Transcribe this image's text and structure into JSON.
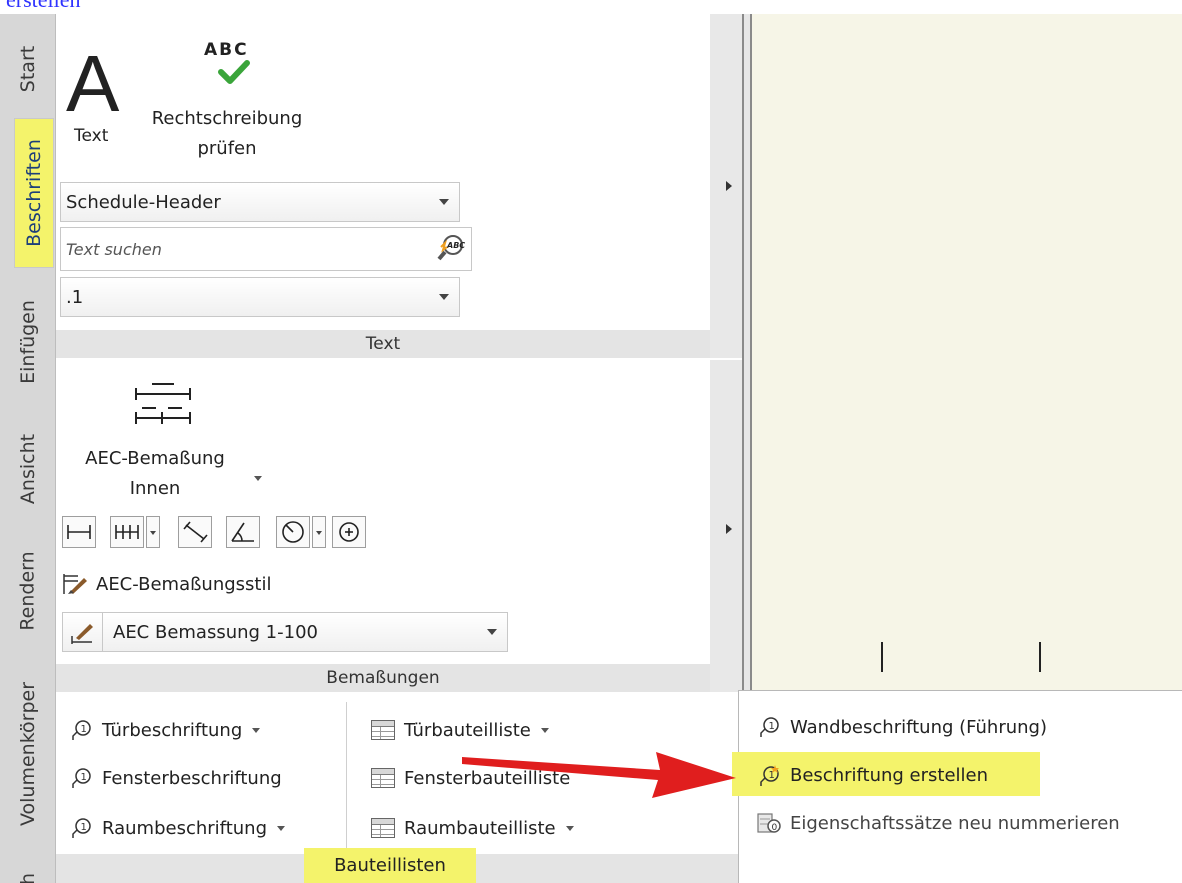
{
  "header_link": "erstellen",
  "tabs": [
    "Start",
    "Beschriften",
    "Einfügen",
    "Ansicht",
    "Rendern",
    "Volumenkörper",
    "h"
  ],
  "text_panel": {
    "text_button": "Text",
    "text_glyph": "A",
    "spell_button": "Rechtschreibung prüfen",
    "spell_icon_text": "ABC",
    "style_combo": "Schedule-Header",
    "search_placeholder": "Text suchen",
    "height_combo": ".1",
    "title": "Text"
  },
  "dim_panel": {
    "dim_button_line1": "AEC-Bemaßung",
    "dim_button_line2": "Innen",
    "style_button": "AEC-Bemaßungsstil",
    "style_combo": "AEC Bemassung 1-100",
    "title": "Bemaßungen"
  },
  "schedule_panel": {
    "tags": [
      "Türbeschriftung",
      "Fensterbeschriftung",
      "Raumbeschriftung"
    ],
    "tables": [
      "Türbauteilliste",
      "Fensterbauteilliste",
      "Raumbauteilliste"
    ],
    "title": "Bauteillisten"
  },
  "flyout": {
    "items": [
      "Wandbeschriftung (Führung)",
      "Beschriftung erstellen",
      "Eigenschaftssätze neu nummerieren"
    ]
  },
  "colors": {
    "highlight": "#f4f36b",
    "arrow": "#e01e1e",
    "canvas": "#f6f5e7"
  }
}
